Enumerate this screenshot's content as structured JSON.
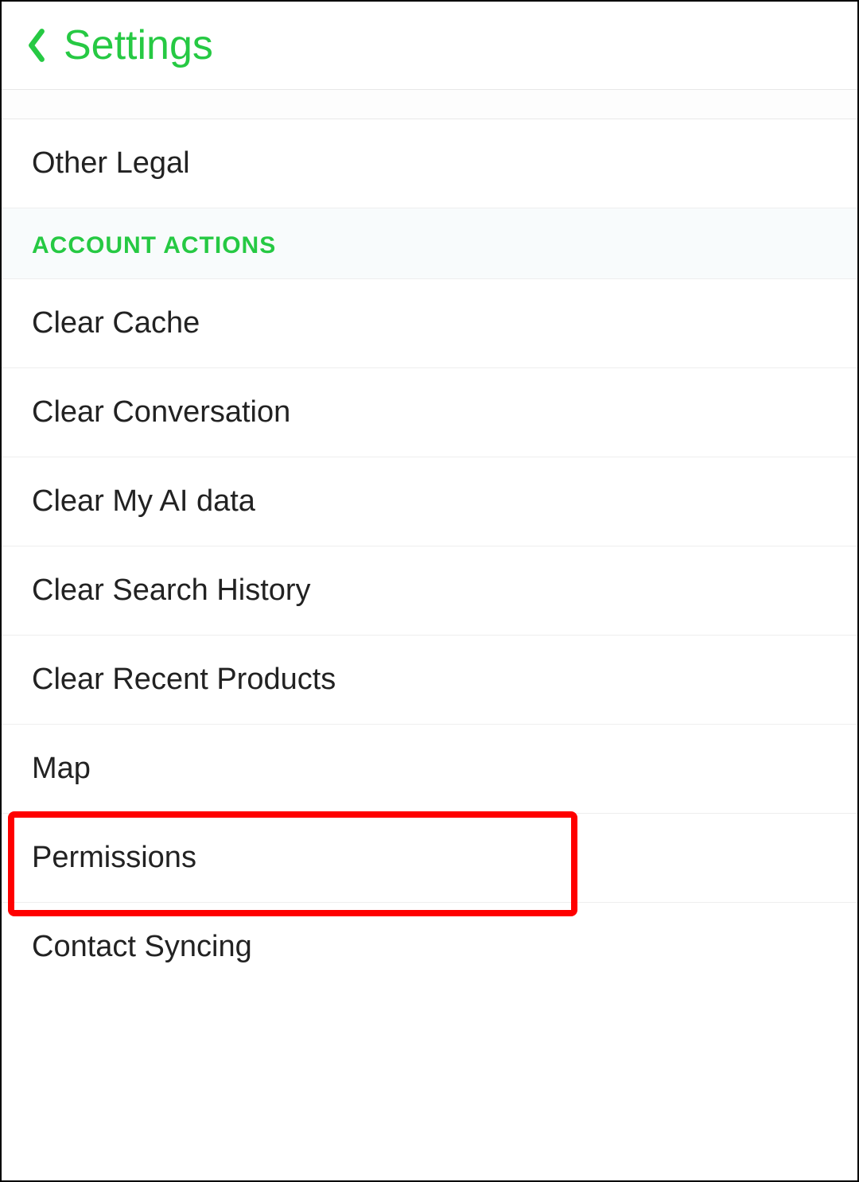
{
  "header": {
    "title": "Settings"
  },
  "items": {
    "other_legal": "Other Legal",
    "section_account_actions": "ACCOUNT ACTIONS",
    "clear_cache": "Clear Cache",
    "clear_conversation": "Clear Conversation",
    "clear_my_ai_data": "Clear My AI data",
    "clear_search_history": "Clear Search History",
    "clear_recent_products": "Clear Recent Products",
    "map": "Map",
    "permissions": "Permissions",
    "contact_syncing": "Contact Syncing"
  }
}
